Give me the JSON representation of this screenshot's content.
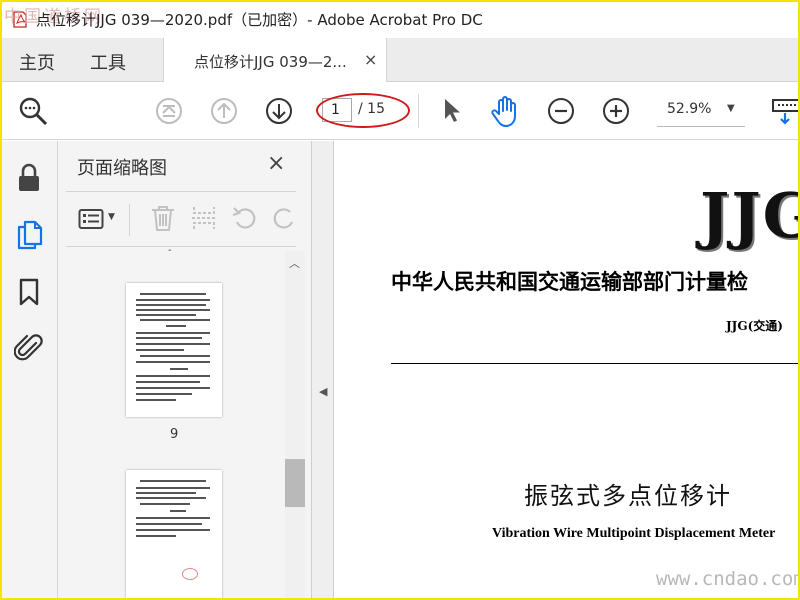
{
  "window": {
    "title": "点位移计JJG 039—2020.pdf（已加密）- Adobe Acrobat Pro DC",
    "watermark_corner": "中国道桥网"
  },
  "tabs": {
    "home": "主页",
    "tools": "工具",
    "document": "点位移计JJG 039—2...",
    "document_close": "×"
  },
  "toolbar": {
    "current_page": "1",
    "page_total": "/ 15",
    "zoom": "52.9%",
    "icons": [
      "search-zoom-icon",
      "first-page-icon",
      "previous-page-icon",
      "next-page-icon",
      "select-arrow-icon",
      "hand-icon",
      "zoom-out-icon",
      "zoom-in-icon",
      "keyboard-icon"
    ]
  },
  "rail": {
    "icons": [
      "lock-icon",
      "pages-icon",
      "bookmark-icon",
      "attachment-icon"
    ]
  },
  "panel": {
    "title": "页面缩略图",
    "close": "×",
    "thumbnails": [
      {
        "page_label": "9"
      },
      {
        "page_label": ""
      }
    ]
  },
  "document": {
    "logo_text": "JJG",
    "heading": "中华人民共和国交通运输部部门计量检",
    "code": "JJG(交通)",
    "title_cn": "振弦式多点位移计",
    "title_en": "Vibration Wire Multipoint Displacement Meter",
    "watermark": "www.cndao.com"
  },
  "colors": {
    "frame": "#f2e600",
    "annotation": "#d01a1a",
    "accent": "#1473e6"
  }
}
